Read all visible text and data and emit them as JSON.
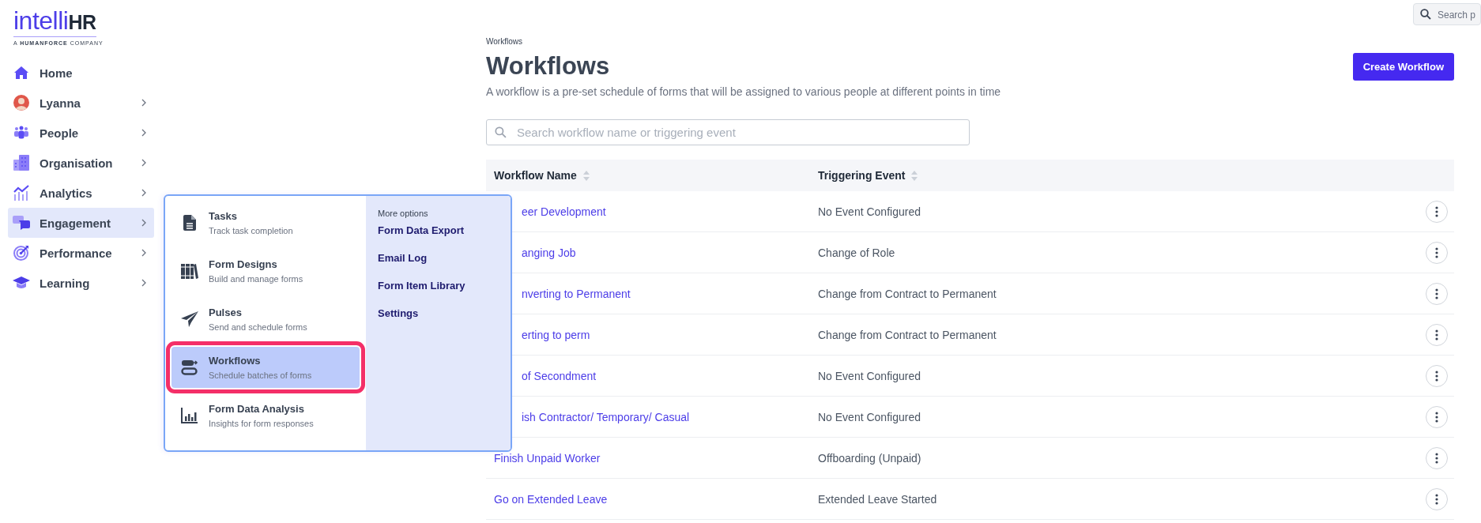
{
  "logo": {
    "brand_main": "intelli",
    "brand_suffix": "HR",
    "tagline": "A **HUMANFORCE** COMPANY"
  },
  "top_search": {
    "placeholder": "Search p"
  },
  "sidebar": {
    "items": [
      {
        "label": "Home",
        "selected": false,
        "expandable": false
      },
      {
        "label": "Lyanna",
        "selected": false,
        "expandable": true
      },
      {
        "label": "People",
        "selected": false,
        "expandable": true
      },
      {
        "label": "Organisation",
        "selected": false,
        "expandable": true
      },
      {
        "label": "Analytics",
        "selected": false,
        "expandable": true
      },
      {
        "label": "Engagement",
        "selected": true,
        "expandable": true
      },
      {
        "label": "Performance",
        "selected": false,
        "expandable": true
      },
      {
        "label": "Learning",
        "selected": false,
        "expandable": true
      }
    ]
  },
  "flyout_menu": {
    "items": [
      {
        "title": "Tasks",
        "subtitle": "Track task completion",
        "selected": false
      },
      {
        "title": "Form Designs",
        "subtitle": "Build and manage forms",
        "selected": false
      },
      {
        "title": "Pulses",
        "subtitle": "Send and schedule forms",
        "selected": false
      },
      {
        "title": "Workflows",
        "subtitle": "Schedule batches of forms",
        "selected": true
      },
      {
        "title": "Form Data Analysis",
        "subtitle": "Insights for form responses",
        "selected": false
      }
    ],
    "more_heading": "More options",
    "more_links": [
      "Form Data Export",
      "Email Log",
      "Form Item Library",
      "Settings"
    ]
  },
  "breadcrumb": "Workflows",
  "page_title": "Workflows",
  "create_button": "Create Workflow",
  "description": "A workflow is a pre-set schedule of forms that will be assigned to various people at different points in time",
  "search": {
    "placeholder": "Search workflow name or triggering event"
  },
  "table": {
    "columns": [
      "Workflow Name",
      "Triggering Event"
    ],
    "rows": [
      {
        "name": "eer Development",
        "event": "No Event Configured",
        "covered": true
      },
      {
        "name": "anging Job",
        "event": "Change of Role",
        "covered": true
      },
      {
        "name": "nverting to Permanent",
        "event": "Change from Contract to Permanent",
        "covered": true
      },
      {
        "name": "erting to perm",
        "event": "Change from Contract to Permanent",
        "covered": true
      },
      {
        "name": "of Secondment",
        "event": "No Event Configured",
        "covered": true
      },
      {
        "name": "ish Contractor/ Temporary/ Casual",
        "event": "No Event Configured",
        "covered": true
      },
      {
        "name": "Finish Unpaid Worker",
        "event": "Offboarding (Unpaid)",
        "covered": false
      },
      {
        "name": "Go on Extended Leave",
        "event": "Extended Leave Started",
        "covered": false
      }
    ]
  }
}
